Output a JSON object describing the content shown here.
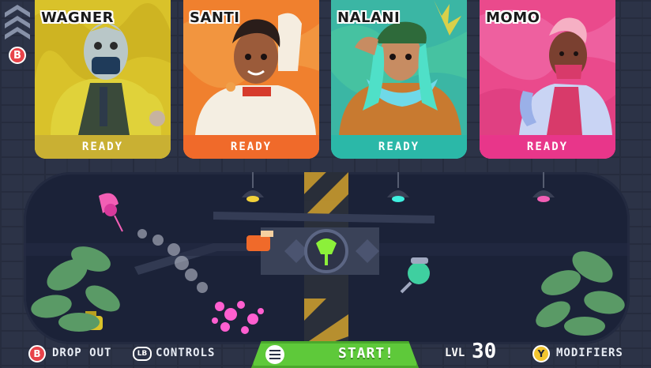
{
  "header": {
    "back_button_glyph": "B"
  },
  "characters": [
    {
      "name": "WAGNER",
      "status": "READY",
      "color": "#d9c22a"
    },
    {
      "name": "SANTI",
      "status": "READY",
      "color": "#f06a2a"
    },
    {
      "name": "NALANI",
      "status": "READY",
      "color": "#2bb8a8"
    },
    {
      "name": "MOMO",
      "status": "READY",
      "color": "#e8368a"
    }
  ],
  "footer": {
    "dropout_glyph": "B",
    "dropout_label": "DROP OUT",
    "controls_glyph": "LB",
    "controls_label": "CONTROLS",
    "start_label": "START!",
    "level_label": "LVL",
    "level_value": "30",
    "modifiers_glyph": "Y",
    "modifiers_label": "MODIFIERS"
  },
  "colors": {
    "start_green": "#5ec93a",
    "b_button_red": "#e8434a",
    "y_button_yellow": "#f2c530",
    "lamp_yellow": "#f2d13a",
    "lamp_cyan": "#3ff0e0",
    "lamp_pink": "#f25fb5"
  }
}
